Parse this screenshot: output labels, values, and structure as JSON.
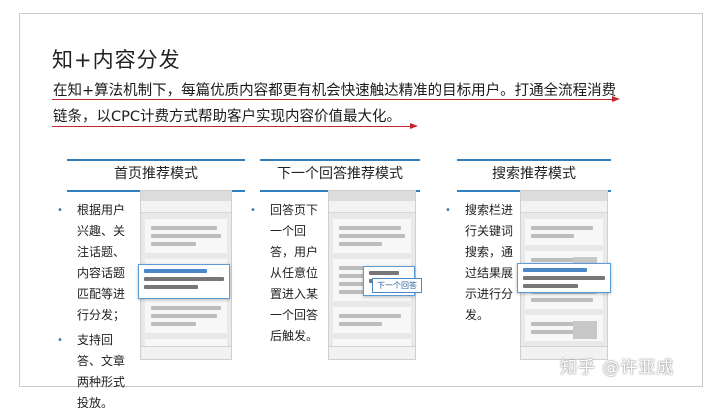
{
  "slide": {
    "title": "知+内容分发",
    "intro": "在知+算法机制下，每篇优质内容都更有机会快速触达精准的目标用户。打通全流程消费链条，以CPC计费方式帮助客户实现内容价值最大化。",
    "accent_color": "#c0282d",
    "heading_bar_color": "#2f7fc1"
  },
  "columns": [
    {
      "heading": "首页推荐模式",
      "bullets": [
        "根据用户兴趣、关注话题、内容话题匹配等进行分发；",
        "支持回答、文章两种形式投放。"
      ]
    },
    {
      "heading": "下一个回答推荐模式",
      "bullets": [
        "回答页下一个回答，用户从任意位置进入某一个回答后触发。"
      ],
      "phone_button": "下一个回答"
    },
    {
      "heading": "搜索推荐模式",
      "bullets": [
        "搜索栏进行关键词搜索，通过结果展示进行分发。"
      ]
    }
  ],
  "watermark": "知乎 @许亚成"
}
